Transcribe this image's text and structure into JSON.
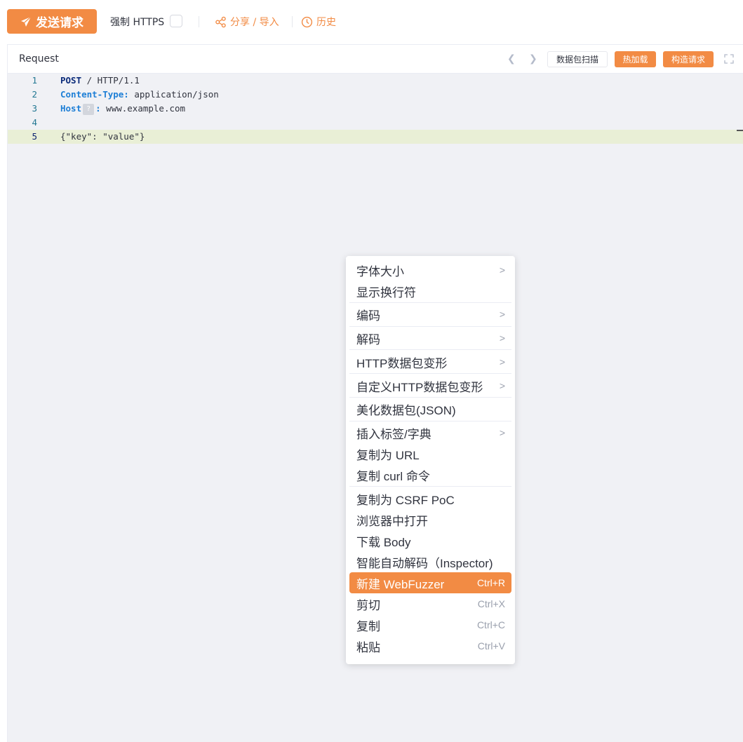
{
  "toolbar": {
    "send_label": "发送请求",
    "https_label": "强制 HTTPS",
    "share_label": "分享 / 导入",
    "history_label": "历史"
  },
  "request": {
    "title": "Request",
    "scan_label": "数据包扫描",
    "hotload_label": "热加载",
    "build_label": "构造请求"
  },
  "editor": {
    "line_numbers": [
      "1",
      "2",
      "3",
      "4",
      "5"
    ],
    "line1": {
      "method": "POST",
      "rest": " / HTTP/1.1"
    },
    "line2": {
      "key": "Content-Type:",
      "value": " application/json"
    },
    "line3": {
      "key": "Host",
      "badge": "?",
      "colon": ":",
      "value": " www.example.com"
    },
    "line5": {
      "text": "{\"key\": \"value\"}"
    }
  },
  "context_menu": {
    "items": [
      {
        "label": "字体大小",
        "submenu": ">"
      },
      {
        "label": "显示换行符"
      },
      {
        "label": "编码",
        "submenu": ">"
      },
      {
        "label": "解码",
        "submenu": ">"
      },
      {
        "label": "HTTP数据包变形",
        "submenu": ">"
      },
      {
        "label": "自定义HTTP数据包变形",
        "submenu": ">"
      },
      {
        "label": "美化数据包(JSON)"
      },
      {
        "label": "插入标签/字典",
        "submenu": ">"
      },
      {
        "label": "复制为 URL"
      },
      {
        "label": "复制 curl 命令"
      },
      {
        "label": "复制为 CSRF PoC"
      },
      {
        "label": "浏览器中打开"
      },
      {
        "label": "下载 Body"
      },
      {
        "label": "智能自动解码（Inspector)"
      },
      {
        "label": "新建 WebFuzzer",
        "shortcut": "Ctrl+R"
      },
      {
        "label": "剪切",
        "shortcut": "Ctrl+X"
      },
      {
        "label": "复制",
        "shortcut": "Ctrl+C"
      },
      {
        "label": "粘贴",
        "shortcut": "Ctrl+V"
      }
    ]
  },
  "colors": {
    "accent": "#f28b44",
    "editor_bg": "#f0f1f5",
    "active_line": "#e9efd6"
  }
}
